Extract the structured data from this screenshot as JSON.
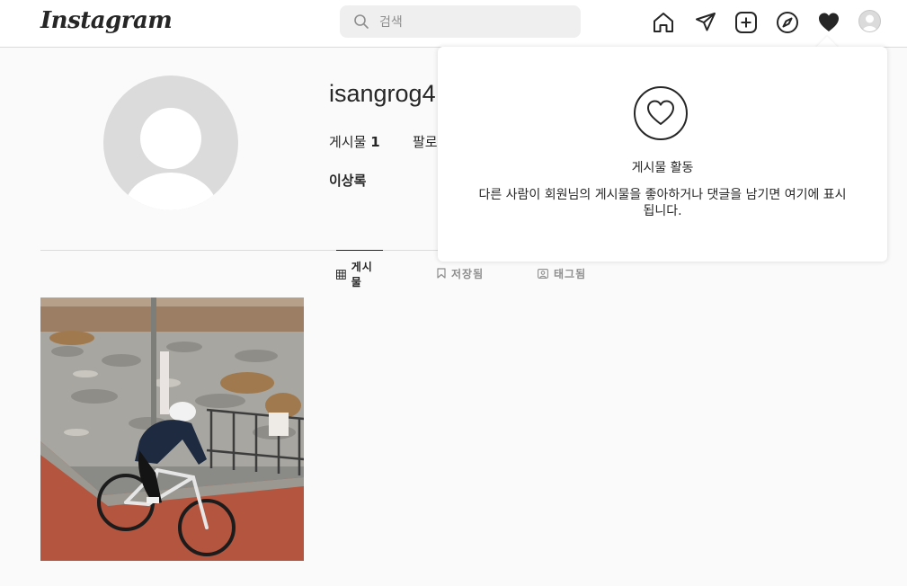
{
  "header": {
    "logo": "Instagram",
    "search": {
      "placeholder": "검색",
      "value": ""
    },
    "icons": [
      "home-icon",
      "direct-icon",
      "new-post-icon",
      "explore-icon",
      "activity-heart-icon",
      "profile-avatar-icon"
    ]
  },
  "profile": {
    "username": "isangrog4",
    "posts_label": "게시물",
    "posts_count": "1",
    "followers_label_partial": "팔로",
    "full_name": "이상록"
  },
  "tabs": [
    {
      "label": "게시물",
      "icon": "grid-icon",
      "active": true
    },
    {
      "label": "저장됨",
      "icon": "bookmark-icon",
      "active": false
    },
    {
      "label": "태그됨",
      "icon": "tagged-icon",
      "active": false
    }
  ],
  "activity_popover": {
    "title": "게시물 활동",
    "description": "다른 사람이 회원님의 게시물을 좋아하거나 댓글을 남기면 여기에 표시됩니다."
  },
  "colors": {
    "background": "#fafafa",
    "border": "#dbdbdb",
    "text": "#262626",
    "muted": "#8e8e8e"
  }
}
